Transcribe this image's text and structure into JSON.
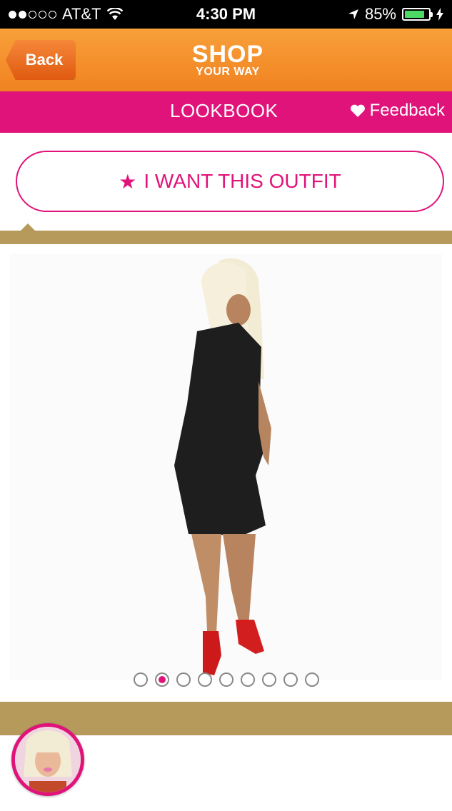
{
  "status_bar": {
    "carrier": "AT&T",
    "time": "4:30 PM",
    "battery": "85%"
  },
  "nav": {
    "back_label": "Back",
    "logo_line1": "SHOP",
    "logo_line2": "YOUR WAY"
  },
  "subnav": {
    "title": "LOOKBOOK",
    "feedback_label": "Feedback"
  },
  "cta": {
    "label": "I WANT THIS OUTFIT"
  },
  "pager": {
    "count": 9,
    "active_index": 1
  },
  "colors": {
    "accent": "#e0137a",
    "nav": "#f39131",
    "gold": "#b59a5c"
  }
}
